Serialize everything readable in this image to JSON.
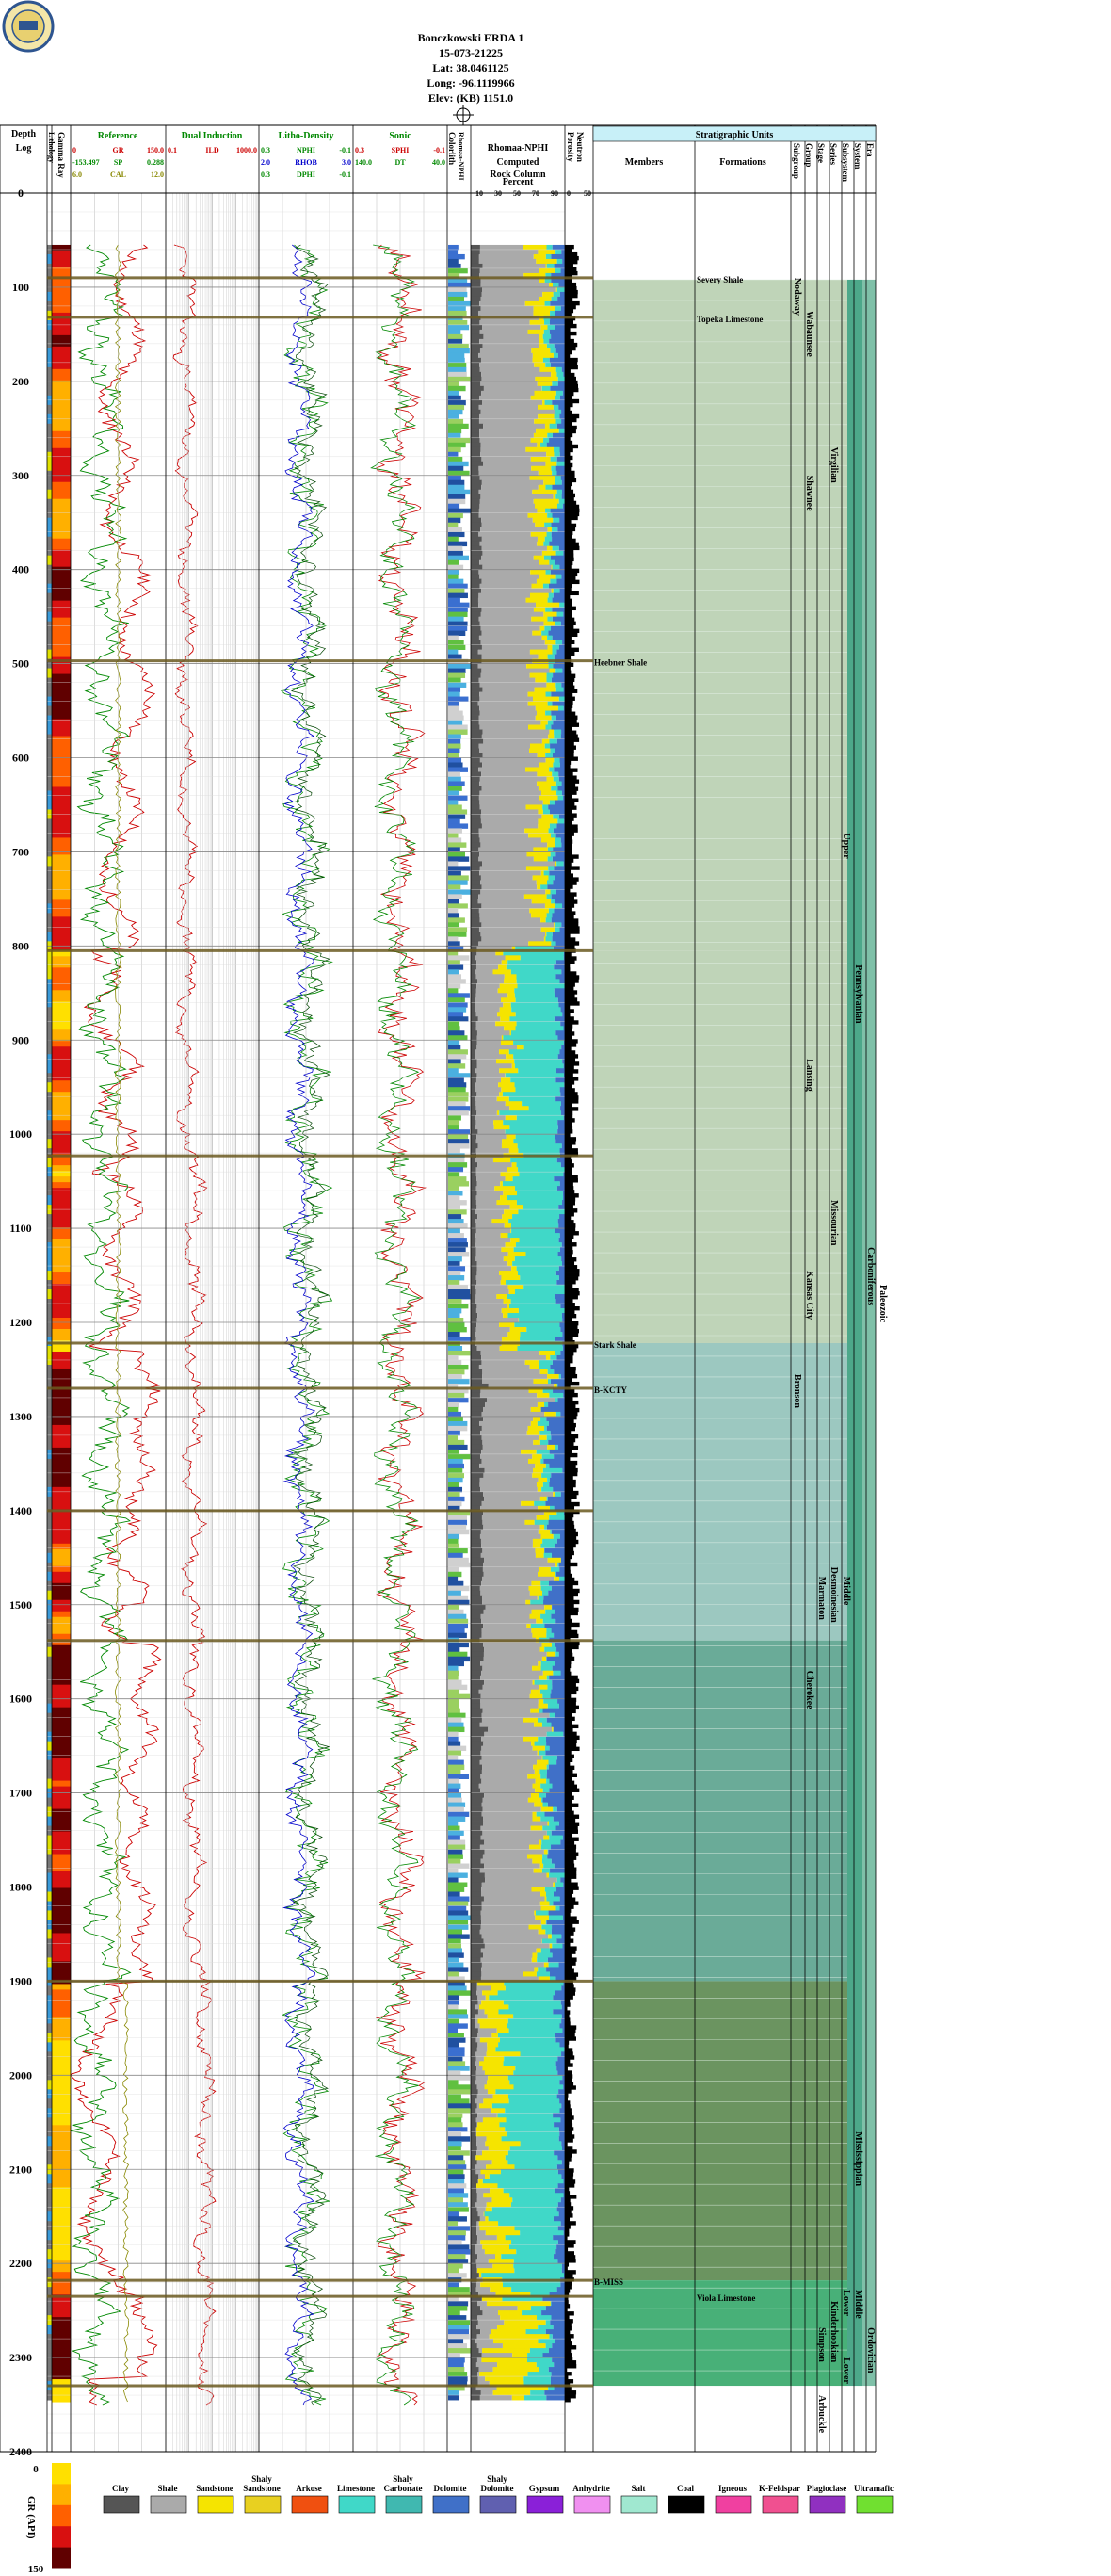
{
  "well": {
    "name": "Bonczkowski ERDA 1",
    "api": "15-073-21225",
    "lat": "Lat: 38.0461125",
    "long": "Long: -96.1119966",
    "elev": "Elev: (KB) 1151.0"
  },
  "headers": {
    "depth": "Depth",
    "log": "Log",
    "lithology": "Lithology",
    "gamma_ray": "Gamma Ray",
    "reference": "Reference",
    "dual_induction": "Dual Induction",
    "litho_density": "Litho-Density",
    "sonic": "Sonic",
    "colorlith": "Colorlith",
    "rhomaa_nphi": "Rhomaa-NPHI",
    "rhomaa_nphi_title": "Rhomaa-NPHI",
    "computed": "Computed",
    "rock_column": "Rock Column",
    "percent": "Percent",
    "porosity": "Porosity",
    "neutron": "Neutron",
    "strat_units": "Stratigraphic Units",
    "members": "Members",
    "formations": "Formations",
    "strat_cols": [
      "Subgroup",
      "Group",
      "Stage",
      "Series",
      "Subsystem",
      "System",
      "Era"
    ]
  },
  "curves": {
    "reference": [
      {
        "min": "0",
        "name": "GR",
        "max": "150.0",
        "color": "#cc0000"
      },
      {
        "min": "-153.497",
        "name": "SP",
        "max": "0.288",
        "color": "#008800"
      },
      {
        "min": "6.0",
        "name": "CAL",
        "max": "12.0",
        "color": "#888800"
      }
    ],
    "dual_induction": [
      {
        "min": "0.1",
        "name": "ILD",
        "max": "1000.0",
        "color": "#cc0000"
      }
    ],
    "litho_density": [
      {
        "min": "0.3",
        "name": "NPHI",
        "max": "-0.1",
        "color": "#008800"
      },
      {
        "min": "2.0",
        "name": "RHOB",
        "max": "3.0",
        "color": "#0000cc"
      },
      {
        "min": "0.3",
        "name": "DPHI",
        "max": "-0.1",
        "color": "#008800"
      }
    ],
    "sonic": [
      {
        "min": "0.3",
        "name": "SPHI",
        "max": "-0.1",
        "color": "#cc0000"
      },
      {
        "min": "140.0",
        "name": "DT",
        "max": "40.0",
        "color": "#008800"
      }
    ]
  },
  "percent_ticks": [
    "10",
    "30",
    "50",
    "70",
    "90"
  ],
  "porosity_ticks": [
    "0",
    "50"
  ],
  "depth_ticks": [
    "0",
    "100",
    "200",
    "300",
    "400",
    "500",
    "600",
    "700",
    "800",
    "900",
    "1000",
    "1100",
    "1200",
    "1300",
    "1400",
    "1500",
    "1600",
    "1700",
    "1800",
    "1900",
    "2000",
    "2100",
    "2200",
    "2300",
    "2400"
  ],
  "tops": [
    {
      "name": "Severy Shale",
      "depth": 90
    },
    {
      "name": "Topeka Limestone",
      "depth": 132
    },
    {
      "name": "Heebner Shale",
      "depth": 497
    },
    {
      "name": "Stark Shale",
      "depth": 1222
    },
    {
      "name": "B-KCTY",
      "depth": 1270
    },
    {
      "name": "B-MISS",
      "depth": 2218
    },
    {
      "name": "Viola Limestone",
      "depth": 2235
    }
  ],
  "strat_labels": [
    {
      "text": "Wabaunsee",
      "col": 1,
      "depth": 125
    },
    {
      "text": "Nodaway",
      "col": 0,
      "depth": 90
    },
    {
      "text": "Virgilian",
      "col": 3,
      "depth": 270
    },
    {
      "text": "Shawnee",
      "col": 1,
      "depth": 300
    },
    {
      "text": "Upper",
      "col": 4,
      "depth": 680
    },
    {
      "text": "Pennsylvanian",
      "col": 5,
      "depth": 820
    },
    {
      "text": "Lansing",
      "col": 1,
      "depth": 920
    },
    {
      "text": "Missourian",
      "col": 3,
      "depth": 1070
    },
    {
      "text": "Kansas City",
      "col": 1,
      "depth": 1145
    },
    {
      "text": "Carboniferous",
      "col": 6,
      "depth": 1120
    },
    {
      "text": "Paleozoic",
      "col": 7,
      "depth": 1160
    },
    {
      "text": "Bronson",
      "col": 0,
      "depth": 1255
    },
    {
      "text": "Middle",
      "col": 4,
      "depth": 1470
    },
    {
      "text": "Desmoinesian",
      "col": 3,
      "depth": 1460
    },
    {
      "text": "Marmaton",
      "col": 2,
      "depth": 1470
    },
    {
      "text": "Cherokee",
      "col": 1,
      "depth": 1570
    },
    {
      "text": "Mississippian",
      "col": 5,
      "depth": 2060
    },
    {
      "text": "Lower",
      "col": 4,
      "depth": 2228
    },
    {
      "text": "Middle",
      "col": 5,
      "depth": 2228
    },
    {
      "text": "Kinderhookian",
      "col": 3,
      "depth": 2240
    },
    {
      "text": "Ordovician",
      "col": 6,
      "depth": 2268
    },
    {
      "text": "Simpson",
      "col": 2,
      "depth": 2268
    },
    {
      "text": "Lower",
      "col": 4,
      "depth": 2300
    },
    {
      "text": "Arbuckle",
      "col": 2,
      "depth": 2340
    }
  ],
  "gr_scale": {
    "label": "GR (API)",
    "min": "0",
    "max": "150"
  },
  "legend": [
    {
      "name": "Clay",
      "color": "#555555"
    },
    {
      "name": "Shale",
      "color": "#aaaaaa"
    },
    {
      "name": "Sandstone",
      "color": "#f5e400"
    },
    {
      "name": "Shaly Sandstone",
      "color": "#e8d020"
    },
    {
      "name": "Arkose",
      "color": "#f05010"
    },
    {
      "name": "Limestone",
      "color": "#40d8c8"
    },
    {
      "name": "Shaly Carbonate",
      "color": "#40b8b0"
    },
    {
      "name": "Dolomite",
      "color": "#4070c8"
    },
    {
      "name": "Shaly Dolomite",
      "color": "#6060b0"
    },
    {
      "name": "Gypsum",
      "color": "#8a20d8"
    },
    {
      "name": "Anhydrite",
      "color": "#f090f0"
    },
    {
      "name": "Salt",
      "color": "#a0e8d0"
    },
    {
      "name": "Coal",
      "color": "#000000"
    },
    {
      "name": "Igneous",
      "color": "#f040a0"
    },
    {
      "name": "K-Feldspar",
      "color": "#f05090"
    },
    {
      "name": "Plagioclase",
      "color": "#9030c0"
    },
    {
      "name": "Ultramafic",
      "color": "#70e030"
    }
  ],
  "colors": {
    "strat_header_bg": "#c8f0f8",
    "pennsylvanian": "#bfd4b8",
    "lower_penn": "#9cc8c0",
    "cherokee": "#6aab98",
    "mississippian": "#6b9460",
    "ordovician": "#48b078",
    "era_band": "#4da88a"
  }
}
